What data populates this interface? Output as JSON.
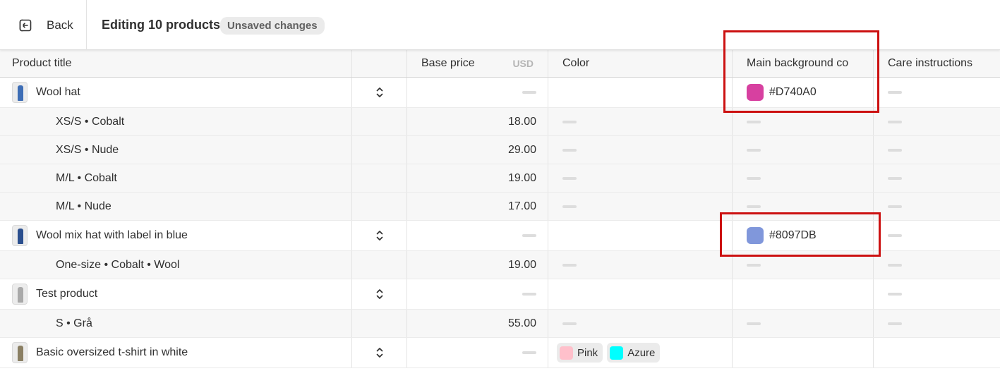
{
  "header": {
    "back_label": "Back",
    "title": "Editing 10 products",
    "badge": "Unsaved changes"
  },
  "columns": {
    "product_title": "Product title",
    "base_price": "Base price",
    "currency": "USD",
    "color": "Color",
    "main_bg": "Main background co",
    "care": "Care instructions"
  },
  "rows": [
    {
      "type": "product",
      "title": "Wool hat",
      "bg_hex": "#D740A0",
      "bg_swatch": "#D740A0",
      "thumb_color": "#3d6db5"
    },
    {
      "type": "variant",
      "title": "XS/S • Cobalt",
      "price": "18.00"
    },
    {
      "type": "variant",
      "title": "XS/S • Nude",
      "price": "29.00"
    },
    {
      "type": "variant",
      "title": "M/L • Cobalt",
      "price": "19.00"
    },
    {
      "type": "variant",
      "title": "M/L • Nude",
      "price": "17.00"
    },
    {
      "type": "product",
      "title": "Wool mix hat with label in blue",
      "bg_hex": "#8097DB",
      "bg_swatch": "#8097DB",
      "thumb_color": "#2b4f8e"
    },
    {
      "type": "variant",
      "title": "One-size • Cobalt • Wool",
      "price": "19.00"
    },
    {
      "type": "product",
      "title": "Test product",
      "thumb_color": "#a9a9a9"
    },
    {
      "type": "variant",
      "title": "S • Grå",
      "price": "55.00"
    },
    {
      "type": "product",
      "title": "Basic oversized t-shirt in white",
      "thumb_color": "#8a7f63",
      "colors": [
        {
          "label": "Pink",
          "swatch": "#FFC0CB"
        },
        {
          "label": "Azure",
          "swatch": "#00FFFF"
        }
      ]
    }
  ],
  "icons": {
    "back": "back-arrow-icon",
    "expand": "chevron-up-down-icon"
  }
}
